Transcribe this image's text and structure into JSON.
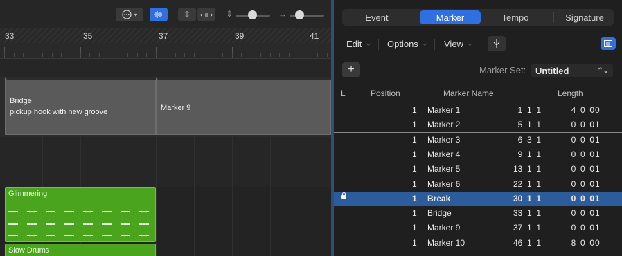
{
  "toolbar": {
    "more_icon": "ellipsis-circle-icon",
    "waveform_icon": "waveform-icon",
    "vertical_zoom_icon": "vertical-fit-icon",
    "horizontal_zoom_icon": "horizontal-fit-icon"
  },
  "ruler": {
    "bars": [
      "33",
      "35",
      "37",
      "39",
      "41"
    ]
  },
  "markers": {
    "bridge": {
      "title": "Bridge",
      "text": "pickup hook with new groove"
    },
    "marker9": {
      "title": "Marker 9"
    }
  },
  "regions": [
    {
      "name": "Glimmering",
      "color": "#4aa41e"
    },
    {
      "name": "Slow Drums",
      "color": "#4aa41e"
    }
  ],
  "tabs": [
    "Event",
    "Marker",
    "Tempo",
    "Signature"
  ],
  "active_tab": "Marker",
  "list_toolbar": {
    "edit": "Edit",
    "options": "Options",
    "view": "View"
  },
  "marker_set": {
    "plus": "+",
    "label": "Marker Set:",
    "value": "Untitled"
  },
  "table": {
    "headers": {
      "lock": "L",
      "position": "Position",
      "name": "Marker Name",
      "length": "Length"
    },
    "rows": [
      {
        "pos": "1  1  1",
        "tick": "1",
        "name": "Marker 1",
        "len": "4  0  0",
        "len_tick": "0"
      },
      {
        "pos": "5  1  1",
        "tick": "1",
        "name": "Marker 2",
        "len": "0  0  0",
        "len_tick": "1"
      },
      {
        "pos": "6  3  1",
        "tick": "1",
        "name": "Marker 3",
        "len": "0  0  0",
        "len_tick": "1"
      },
      {
        "pos": "9  1  1",
        "tick": "1",
        "name": "Marker 4",
        "len": "0  0  0",
        "len_tick": "1"
      },
      {
        "pos": "13  1  1",
        "tick": "1",
        "name": "Marker 5",
        "len": "0  0  0",
        "len_tick": "1"
      },
      {
        "pos": "22  1  1",
        "tick": "1",
        "name": "Marker 6",
        "len": "0  0  0",
        "len_tick": "1"
      },
      {
        "pos": "30  1  1",
        "tick": "1",
        "name": "Break",
        "len": "0  0  0",
        "len_tick": "1",
        "selected": true,
        "locked": true
      },
      {
        "pos": "33  1  1",
        "tick": "1",
        "name": "Bridge",
        "len": "0  0  0",
        "len_tick": "1"
      },
      {
        "pos": "37  1  1",
        "tick": "1",
        "name": "Marker 9",
        "len": "0  0  0",
        "len_tick": "1"
      },
      {
        "pos": "46  1  1",
        "tick": "1",
        "name": "Marker 10",
        "len": "8  0  0",
        "len_tick": "0"
      }
    ]
  },
  "colors": {
    "accent": "#2f6fe0",
    "selection": "#2d5c9a",
    "region_green": "#4aa41e"
  }
}
